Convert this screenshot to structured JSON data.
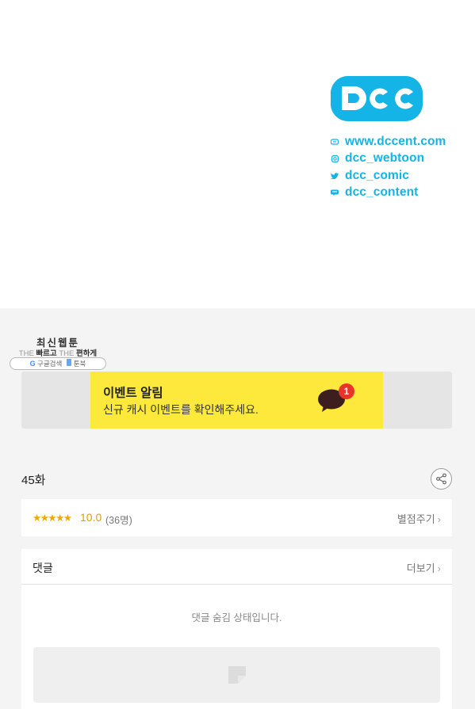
{
  "promo": {
    "logo_text": "DCC",
    "links": [
      {
        "icon": "web-icon",
        "text": "www.dccent.com"
      },
      {
        "icon": "instagram-icon",
        "text": "dcc_webtoon"
      },
      {
        "icon": "twitter-icon",
        "text": "dcc_comic"
      },
      {
        "icon": "chat-icon",
        "text": "dcc_content"
      }
    ],
    "accent_color": "#14b4e6"
  },
  "watermark": {
    "title": "최신웹툰",
    "sub_the1": "THE",
    "sub_fast": "빠르고",
    "sub_the2": "THE",
    "sub_easy": "편하게",
    "search": "구글검색",
    "site": "툰북"
  },
  "banner": {
    "title": "이벤트 알림",
    "text": "신규 캐시 이벤트를 확인해주세요.",
    "badge_count": "1",
    "color": "#fde83c"
  },
  "episode": {
    "title": "45화"
  },
  "rating": {
    "stars": "★★★★★",
    "score": "10.0",
    "count": "(36명)",
    "rate_label": "별점주기",
    "star_color": "#f2a700"
  },
  "comments": {
    "title": "댓글",
    "more_label": "더보기",
    "hidden_message": "댓글 숨김 상태입니다."
  }
}
